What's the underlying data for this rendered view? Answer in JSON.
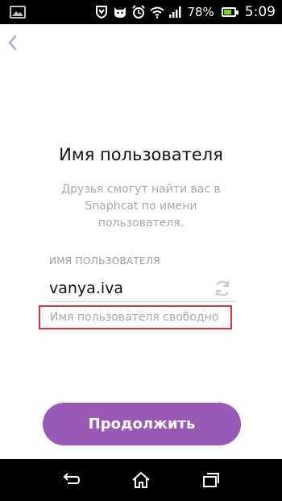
{
  "status_bar": {
    "battery_percent": "78%",
    "battery_level": 0.78,
    "time": "5:09",
    "icons": [
      "gallery-icon",
      "hearing-icon",
      "cat-icon",
      "alarm-icon",
      "wifi-icon",
      "signal-icon",
      "battery-icon"
    ]
  },
  "header": {
    "back_icon": "chevron-left-icon"
  },
  "main": {
    "title": "Имя пользователя",
    "subtitle": "Друзья смогут найти вас в Snaphcat по имени пользователя.",
    "field_label": "ИМЯ ПОЛЬЗОВАТЕЛЯ",
    "username_value": "vanya.iva",
    "refresh_icon": "refresh-icon",
    "availability_text": "Имя пользователя свободно",
    "continue_label": "Продолжить"
  },
  "nav_bar": {
    "icons": [
      "back-icon",
      "home-icon",
      "recent-apps-icon"
    ]
  },
  "colors": {
    "accent": "#9b59b6",
    "highlight_border": "#d9333f",
    "muted_text": "#a9a9a9"
  }
}
